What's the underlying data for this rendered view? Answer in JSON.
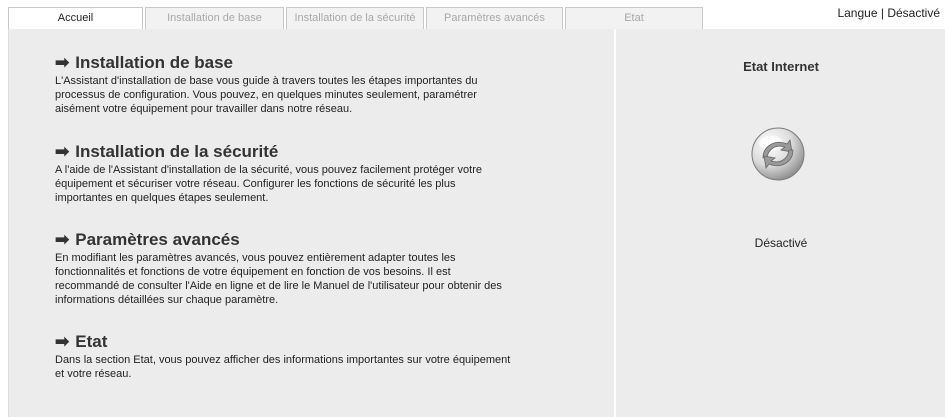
{
  "tabs": [
    {
      "label": "Accueil",
      "active": true
    },
    {
      "label": "Installation de base",
      "active": false
    },
    {
      "label": "Installation de la sécurité",
      "active": false
    },
    {
      "label": "Paramètres avancés",
      "active": false
    },
    {
      "label": "Etat",
      "active": false
    }
  ],
  "language": {
    "label": "Langue",
    "separator": "|",
    "logout": "Désactivé"
  },
  "sections": [
    {
      "arrow": "➡",
      "title": "Installation de base",
      "lines": [
        "L'Assistant d'installation de base vous guide à travers toutes les étapes importantes du",
        "processus de configuration. Vous pouvez, en quelques minutes seulement, paramétrer",
        "aisément votre équipement pour travailler dans notre réseau."
      ]
    },
    {
      "arrow": "➡",
      "title": "Installation de la sécurité",
      "lines": [
        "A l'aide de l'Assistant d'installation de la sécurité, vous pouvez facilement protéger votre",
        "équipement et sécuriser votre réseau. Configurer les fonctions de sécurité les plus",
        "importantes en quelques étapes seulement."
      ]
    },
    {
      "arrow": "➡",
      "title": "Paramètres avancés",
      "lines": [
        "En modifiant les paramètres avancés, vous pouvez entièrement adapter toutes les",
        "fonctionnalités et fonctions de votre équipement en fonction de vos besoins. Il est",
        "recommandé de consulter l'Aide en ligne et de lire le Manuel de l'utilisateur pour obtenir des",
        "informations détaillées sur chaque paramètre."
      ]
    },
    {
      "arrow": "➡",
      "title": "Etat",
      "lines": [
        "Dans la section Etat, vous pouvez afficher des informations importantes sur votre équipement",
        "et votre réseau."
      ]
    }
  ],
  "internet": {
    "title": "Etat Internet",
    "icon": "internet-globe-icon",
    "status": "Désactivé"
  }
}
